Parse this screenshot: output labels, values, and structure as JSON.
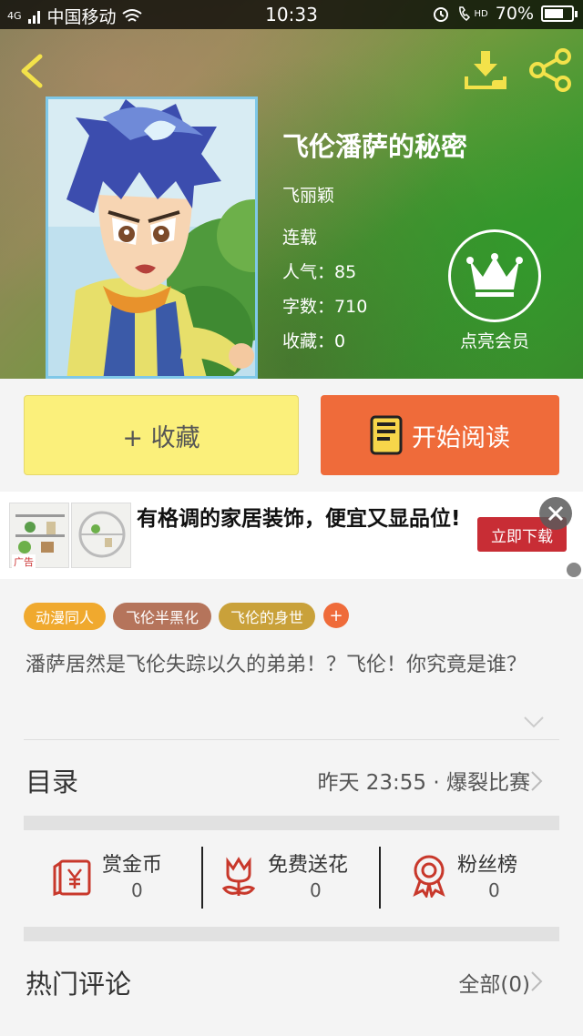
{
  "status_bar": {
    "network": "4G",
    "carrier": "中国移动",
    "time": "10:33",
    "hd_label": "HD",
    "battery_percent": "70%",
    "battery_level": 0.7
  },
  "header": {
    "back_icon": "chevron-left-icon",
    "download_icon": "download-icon",
    "share_icon": "share-icon"
  },
  "book": {
    "title": "飞伦潘萨的秘密",
    "author": "飞丽颖",
    "status": "连载",
    "popularity_label": "人气：",
    "popularity": "85",
    "words_label": "字数：",
    "words": "710",
    "favorites_label": "收藏：",
    "favorites": "0"
  },
  "vip": {
    "label": "点亮会员",
    "icon": "crown-icon"
  },
  "actions": {
    "collect_label": "+ 收藏",
    "read_label": "开始阅读",
    "read_icon": "book-icon"
  },
  "ad": {
    "text": "有格调的家居装饰，便宜又显品位!",
    "button": "立即下载",
    "tag": "广告"
  },
  "tags": [
    {
      "label": "动漫同人",
      "color": "#f0a92e"
    },
    {
      "label": "飞伦半黑化",
      "color": "#b5745b"
    },
    {
      "label": "飞伦的身世",
      "color": "#c9a13a"
    }
  ],
  "tag_more": "+",
  "description": "潘萨居然是飞伦失踪以久的弟弟！？飞伦！你究竟是谁？",
  "toc": {
    "title": "目录",
    "latest": "昨天 23:55 · 爆裂比赛"
  },
  "rewards": [
    {
      "label": "赏金币",
      "value": "0",
      "icon": "red-packet-icon"
    },
    {
      "label": "免费送花",
      "value": "0",
      "icon": "flower-icon"
    },
    {
      "label": "粉丝榜",
      "value": "0",
      "icon": "medal-icon"
    }
  ],
  "comments": {
    "title": "热门评论",
    "all_label": "全部(0)"
  },
  "colors": {
    "accent_orange": "#ef6b3a",
    "collect_yellow": "#fbf07b",
    "icon_red": "#c8382b"
  }
}
